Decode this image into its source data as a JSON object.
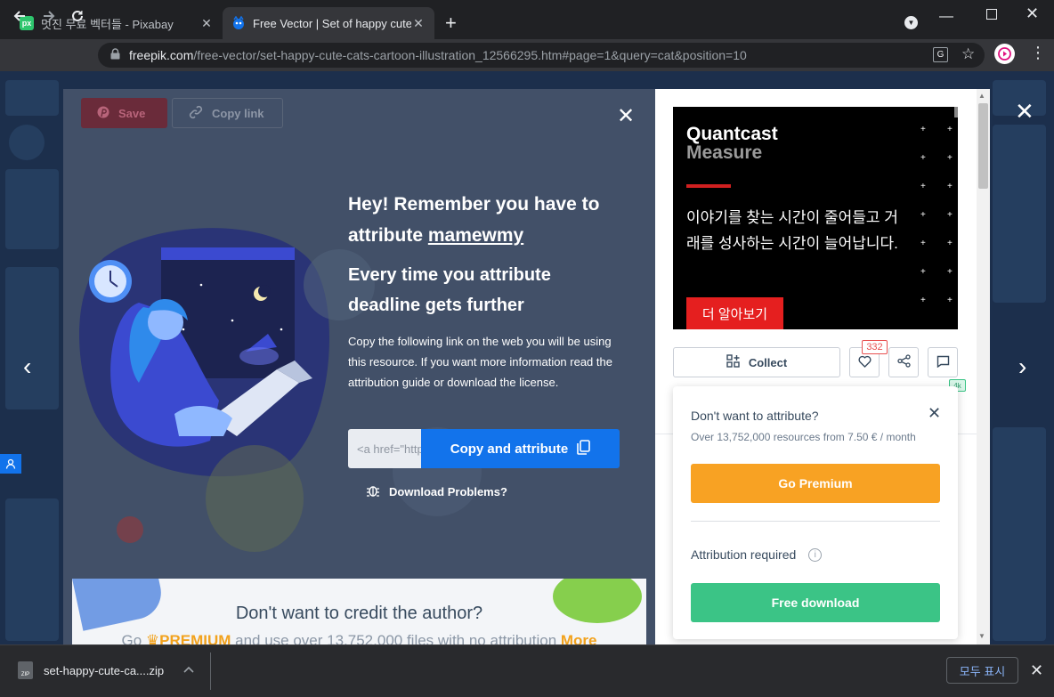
{
  "browser": {
    "tabs": [
      {
        "title": "멋진 무료 벡터들 - Pixabay",
        "favicon": "px"
      },
      {
        "title": "Free Vector | Set of happy cute cats",
        "favicon": "freepik-icon"
      }
    ],
    "new_tab": "+",
    "url_host": "freepik.com",
    "url_path": "/free-vector/set-happy-cute-cats-cartoon-illustration_12566295.htm#page=1&query=cat&position=10"
  },
  "modal": {
    "save_label": "Save",
    "copy_link_label": "Copy link",
    "heading_prefix": "Hey! Remember you have to attribute ",
    "author": "mamewmy",
    "subheading": "Every time you attribute deadline gets further",
    "paragraph": "Copy the following link on the web you will be using this resource. If you want more information read the attribution guide or download the license.",
    "href_placeholder": "<a href=\"https://www.freepik.com",
    "copy_attribute_label": "Copy and attribute",
    "download_problems_label": "Download Problems?",
    "banner_title": "Don't want to credit the author?",
    "banner_text_go": "Go ",
    "banner_premium": "PREMIUM",
    "banner_text_rest": " and use over 13,752,000 files with no attribution",
    "banner_more": "More"
  },
  "ad": {
    "brand_line1": "Quantcast",
    "brand_line2": "Measure",
    "text": "이야기를 찾는 시간이 줄어들고 거래를 성사하는 시간이 늘어납니다.",
    "button": "더 알아보기"
  },
  "actions": {
    "collect_label": "Collect",
    "likes_count": "332",
    "comment_badge": "4k"
  },
  "popup": {
    "title": "Don't want to attribute?",
    "subtitle": "Over 13,752,000 resources from 7.50 € / month",
    "go_premium": "Go Premium",
    "attribution_required": "Attribution required",
    "free_download": "Free download"
  },
  "download_bar": {
    "file_name": "set-happy-cute-ca....zip",
    "show_all": "모두 표시",
    "zip_label": "ZIP"
  },
  "colors": {
    "primary_blue": "#1273eb",
    "premium_orange": "#f8a223",
    "free_green": "#3bc486",
    "ad_red": "#e51f1f"
  }
}
